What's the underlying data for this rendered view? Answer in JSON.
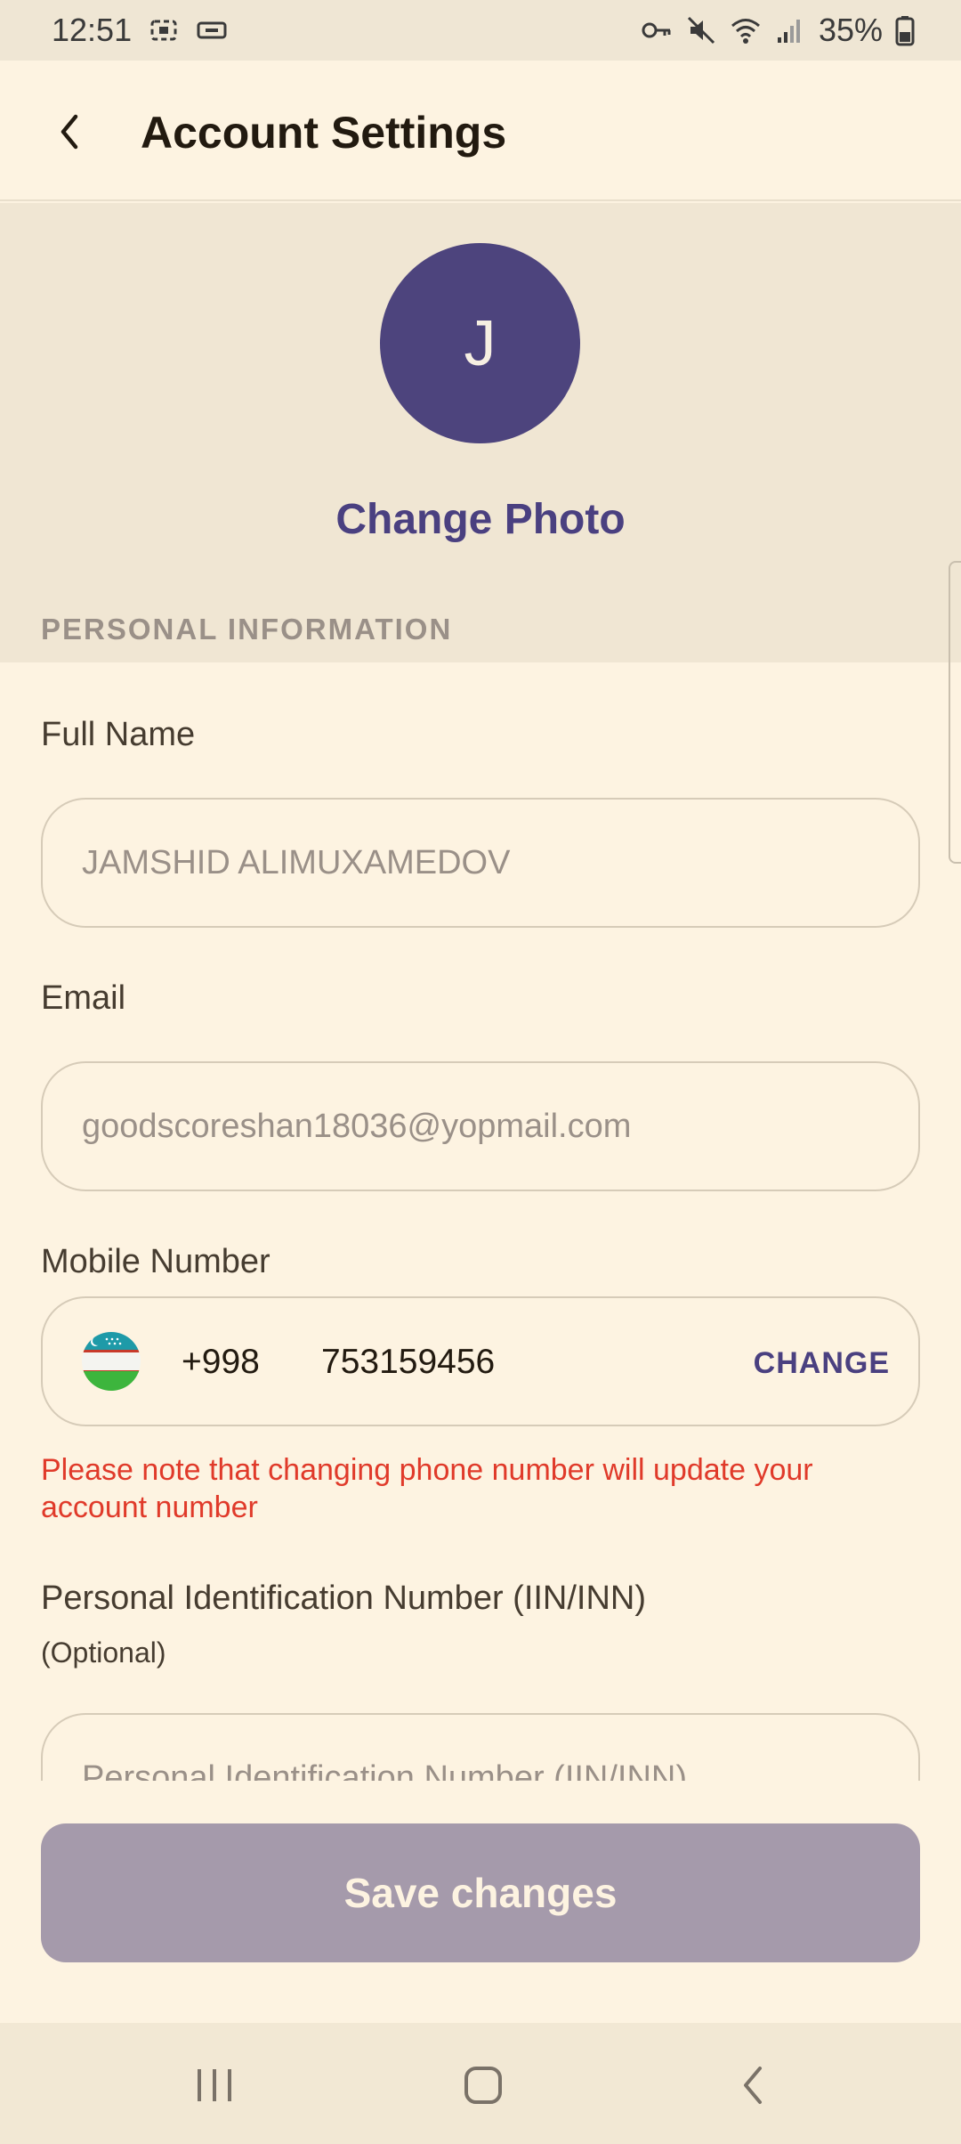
{
  "status_bar": {
    "time": "12:51",
    "battery": "35%"
  },
  "header": {
    "title": "Account Settings"
  },
  "profile": {
    "avatar_initial": "J",
    "change_photo_label": "Change Photo"
  },
  "section": {
    "personal_info_label": "PERSONAL INFORMATION"
  },
  "form": {
    "full_name": {
      "label": "Full Name",
      "value": "JAMSHID ALIMUXAMEDOV"
    },
    "email": {
      "label": "Email",
      "value": "goodscoreshan18036@yopmail.com"
    },
    "mobile": {
      "label": "Mobile Number",
      "country_code": "+998",
      "number": "753159456",
      "change_label": "CHANGE"
    },
    "warning": "Please note that changing phone number will update your account number",
    "iin": {
      "label": "Personal Identification Number (IIN/INN)",
      "optional": "(Optional)",
      "placeholder": "Personal Identification Number (IIN/INN)"
    }
  },
  "save_button": "Save changes",
  "colors": {
    "accent": "#4a4080",
    "avatar_bg": "#4d447d",
    "warning": "#e03a2a",
    "disabled_button": "#a59aab",
    "background": "#fdf3e1"
  },
  "icons": [
    "back-arrow-icon",
    "uzbekistan-flag-icon",
    "recent-apps-icon",
    "home-icon",
    "nav-back-icon"
  ]
}
